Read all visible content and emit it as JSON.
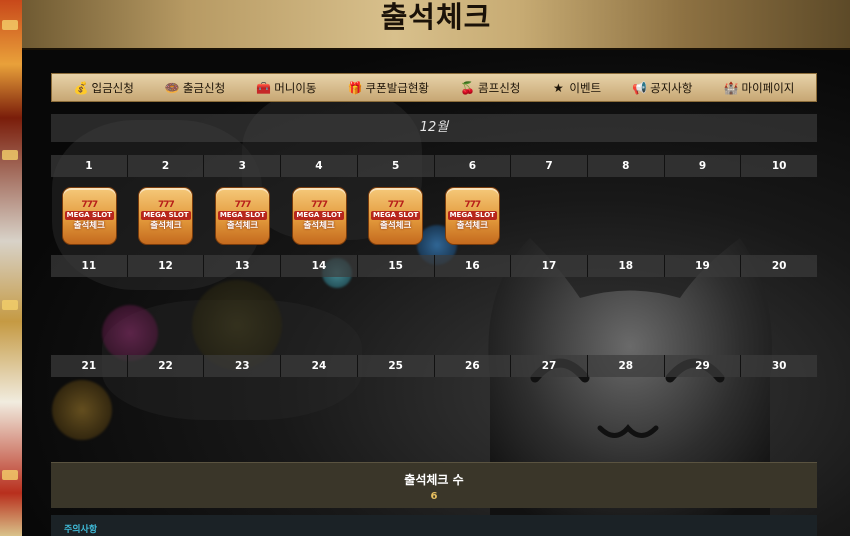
{
  "page": {
    "title": "출석체크"
  },
  "nav": {
    "items": [
      {
        "label": "입금신청",
        "icon": "money-bag-icon",
        "glyph": "💰"
      },
      {
        "label": "출금신청",
        "icon": "donut-coin-icon",
        "glyph": "🍩"
      },
      {
        "label": "머니이동",
        "icon": "treasure-chest-icon",
        "glyph": "🧰"
      },
      {
        "label": "쿠폰발급현황",
        "icon": "coupon-character-icon",
        "glyph": "🎁"
      },
      {
        "label": "콤프신청",
        "icon": "cherry-icon",
        "glyph": "🍒"
      },
      {
        "label": "이벤트",
        "icon": "star-icon",
        "glyph": "★"
      },
      {
        "label": "공지사항",
        "icon": "megaphone-icon",
        "glyph": "📢"
      },
      {
        "label": "마이페이지",
        "icon": "castle-icon",
        "glyph": "🏰"
      }
    ]
  },
  "calendar": {
    "month": "12월",
    "weeks": [
      [
        "1",
        "2",
        "3",
        "4",
        "5",
        "6",
        "7",
        "8",
        "9",
        "10"
      ],
      [
        "11",
        "12",
        "13",
        "14",
        "15",
        "16",
        "17",
        "18",
        "19",
        "20"
      ],
      [
        "21",
        "22",
        "23",
        "24",
        "25",
        "26",
        "27",
        "28",
        "29",
        "30"
      ]
    ],
    "stamps_checked_days": 6,
    "stamp": {
      "crown": "777",
      "brand": "MEGA SLOT",
      "label": "출석체크"
    }
  },
  "summary": {
    "title": "출석체크 수",
    "count": "6"
  },
  "notice": {
    "label": "주의사항"
  },
  "colors": {
    "accent_gold": "#c7a774",
    "count": "#e8c060",
    "notice": "#3fb9d6"
  }
}
